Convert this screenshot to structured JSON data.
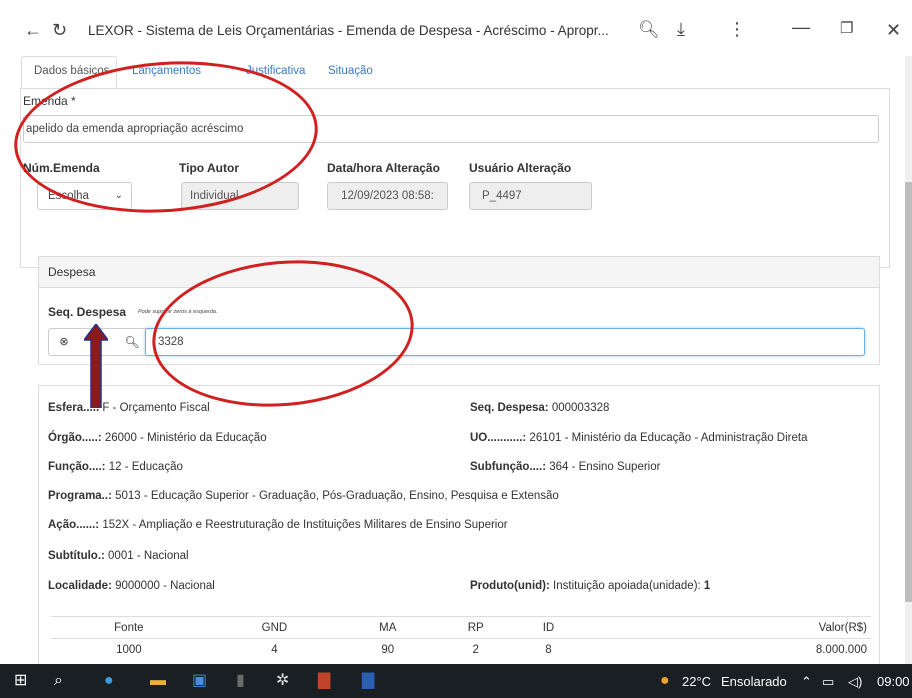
{
  "browser": {
    "title": "LEXOR - Sistema de Leis Orçamentárias - Emenda de Despesa - Acréscimo - Apropr...",
    "back_icon": "back-arrow",
    "reload_icon": "reload",
    "zoom_icon": "zoom",
    "download_icon": "download",
    "menu_icon": "more-vert",
    "minimize_label": "—",
    "restore_label": "❐",
    "close_label": "✕"
  },
  "tabs": [
    {
      "label": "Dados básicos"
    },
    {
      "label": "Lançamentos"
    },
    {
      "label": "Justificativa"
    },
    {
      "label": "Situação"
    }
  ],
  "emenda": {
    "label": "Emenda *",
    "value": "apelido da emenda apropriação acréscimo",
    "num_label": "Núm.Emenda",
    "num_value": "Escolha",
    "tipo_label": "Tipo Autor",
    "tipo_value": "Individual",
    "data_label": "Data/hora Alteração",
    "data_value": "12/09/2023 08:58:",
    "usuario_label": "Usuário Alteração",
    "usuario_value": "P_4497"
  },
  "despesa": {
    "panel_title": "Despesa",
    "seq_label": "Seq. Despesa",
    "hint": "Pode suprimir zeros à esquerda.",
    "seq_value": "3328"
  },
  "details": {
    "esfera_label": "Esfera.....",
    "esfera_value": " F - Orçamento Fiscal",
    "seq_label": "Seq. Despesa:",
    "seq_value": " 000003328",
    "orgao_label": "Órgão.....:",
    "orgao_value": " 26000 - Ministério da Educação",
    "uo_label": "UO...........:",
    "uo_value": " 26101 - Ministério da Educação - Administração Direta",
    "funcao_label": "Função....:",
    "funcao_value": " 12 - Educação",
    "subfuncao_label": "Subfunção....:",
    "subfuncao_value": " 364 - Ensino Superior",
    "programa_label": "Programa..:",
    "programa_value": " 5013 - Educação Superior - Graduação, Pós-Graduação, Ensino, Pesquisa e Extensão",
    "acao_label": "Ação......:",
    "acao_value": " 152X - Ampliação e Reestruturação de Instituições Militares de Ensino Superior",
    "subtitulo_label": "Subtítulo.:",
    "subtitulo_value": " 0001 - Nacional",
    "localidade_label": "Localidade:",
    "localidade_value": " 9000000 - Nacional",
    "produto_label": "Produto(unid):",
    "produto_value": " Instituição apoiada(unidade): ",
    "produto_qtd": "1"
  },
  "table": {
    "headers": [
      "Fonte",
      "GND",
      "MA",
      "RP",
      "ID",
      "Valor(R$)"
    ],
    "rows": [
      [
        "1000",
        "4",
        "90",
        "2",
        "8",
        "8.000.000"
      ]
    ]
  },
  "taskbar": {
    "temperature": "22°C",
    "weather": "Ensolarado",
    "time": "09:00"
  },
  "colors": {
    "annotation": "#d21f1f",
    "arrow": "#8b1a1a",
    "link": "#3a78c2",
    "taskbar": "#1a1f24"
  }
}
